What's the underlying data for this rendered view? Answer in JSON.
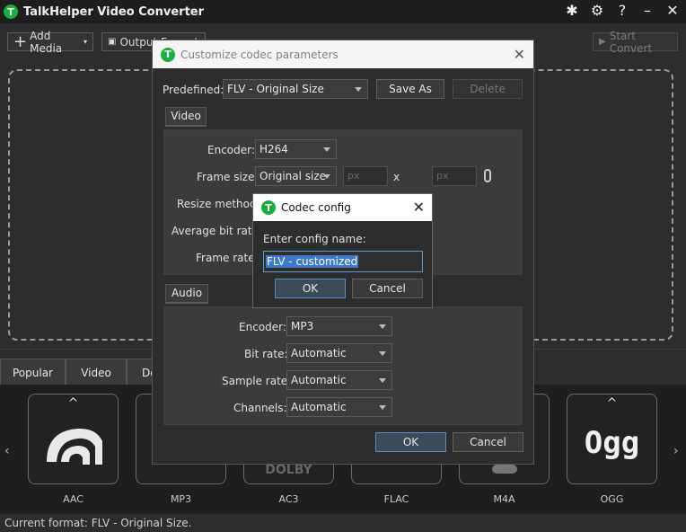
{
  "app": {
    "title": "TalkHelper Video Converter",
    "logo_letter": "T",
    "brand_color": "#1aae3a"
  },
  "titlebar_icons": [
    "bug-icon",
    "gear-icon",
    "help-icon",
    "minimize-icon",
    "close-icon"
  ],
  "toolbar": {
    "add_media": "Add Media",
    "output_format": "Output Format",
    "start_convert": "Start Convert"
  },
  "format_tabs": [
    "Popular",
    "Video",
    "De"
  ],
  "formats": [
    {
      "label": "AAC",
      "icon": "aac-icon"
    },
    {
      "label": "MP3",
      "icon": "mp3-icon"
    },
    {
      "label": "AC3",
      "icon": "dolby-icon",
      "logo_text": "DOLBY"
    },
    {
      "label": "FLAC",
      "icon": "flac-icon"
    },
    {
      "label": "M4A",
      "icon": "m4a-icon"
    },
    {
      "label": "OGG",
      "icon": "ogg-icon",
      "logo_text": "Ogg"
    }
  ],
  "status": "Current format: FLV - Original Size.",
  "codec_dialog": {
    "title": "Customize codec parameters",
    "predefined_label": "Predefined:",
    "predefined_value": "FLV - Original Size",
    "save_as": "Save As",
    "delete": "Delete",
    "video_tab": "Video",
    "encoder_label": "Encoder:",
    "encoder_value": "H264",
    "frame_size_label": "Frame size:",
    "frame_size_value": "Original size",
    "px_placeholder": "px",
    "x_sep": "x",
    "resize_label": "Resize method:",
    "avg_bitrate_label": "Average bit rate:",
    "frame_rate_label": "Frame rate:",
    "audio_tab": "Audio",
    "audio_encoder_label": "Encoder:",
    "audio_encoder_value": "MP3",
    "bitrate_label": "Bit rate:",
    "bitrate_value": "Automatic",
    "sample_rate_label": "Sample rate:",
    "sample_rate_value": "Automatic",
    "channels_label": "Channels:",
    "channels_value": "Automatic",
    "ok": "OK",
    "cancel": "Cancel"
  },
  "config_dialog": {
    "title": "Codec config",
    "prompt": "Enter config name:",
    "value": "FLV - customized",
    "ok": "OK",
    "cancel": "Cancel"
  }
}
